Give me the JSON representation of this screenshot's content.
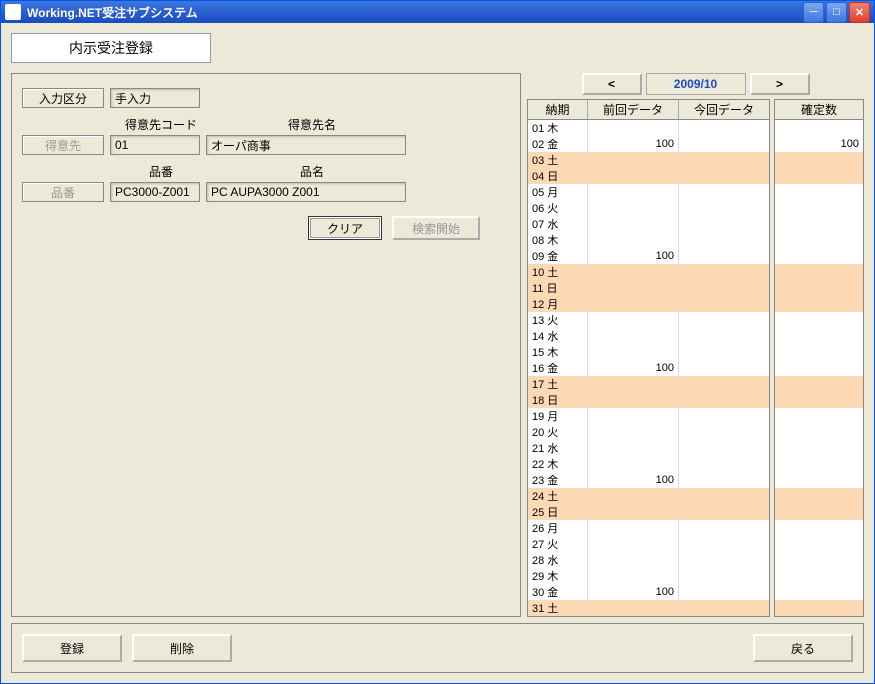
{
  "window": {
    "title": "Working.NET受注サブシステム"
  },
  "page": {
    "title": "内示受注登録"
  },
  "form": {
    "input_div_label": "入力区分",
    "input_div_value": "手入力",
    "customer_btn": "得意先",
    "customer_code_label": "得意先コード",
    "customer_code_value": "01",
    "customer_name_label": "得意先名",
    "customer_name_value": "オーパ商事",
    "product_btn": "品番",
    "product_code_label": "品番",
    "product_code_value": "PC3000-Z001",
    "product_name_label": "品名",
    "product_name_value": "PC AUPA3000 Z001",
    "clear_btn": "クリア",
    "search_btn": "検索開始"
  },
  "month": {
    "display": "2009/10"
  },
  "grid": {
    "headers": {
      "date": "納期",
      "prev": "前回データ",
      "curr": "今回データ",
      "confirmed": "確定数"
    },
    "rows": [
      {
        "d": "01",
        "w": "木",
        "prev": "",
        "curr": "",
        "conf": "",
        "hl": false
      },
      {
        "d": "02",
        "w": "金",
        "prev": "100",
        "curr": "",
        "conf": "100",
        "hl": false
      },
      {
        "d": "03",
        "w": "土",
        "prev": "",
        "curr": "",
        "conf": "",
        "hl": true
      },
      {
        "d": "04",
        "w": "日",
        "prev": "",
        "curr": "",
        "conf": "",
        "hl": true
      },
      {
        "d": "05",
        "w": "月",
        "prev": "",
        "curr": "",
        "conf": "",
        "hl": false
      },
      {
        "d": "06",
        "w": "火",
        "prev": "",
        "curr": "",
        "conf": "",
        "hl": false
      },
      {
        "d": "07",
        "w": "水",
        "prev": "",
        "curr": "",
        "conf": "",
        "hl": false
      },
      {
        "d": "08",
        "w": "木",
        "prev": "",
        "curr": "",
        "conf": "",
        "hl": false
      },
      {
        "d": "09",
        "w": "金",
        "prev": "100",
        "curr": "",
        "conf": "",
        "hl": false
      },
      {
        "d": "10",
        "w": "土",
        "prev": "",
        "curr": "",
        "conf": "",
        "hl": true
      },
      {
        "d": "11",
        "w": "日",
        "prev": "",
        "curr": "",
        "conf": "",
        "hl": true
      },
      {
        "d": "12",
        "w": "月",
        "prev": "",
        "curr": "",
        "conf": "",
        "hl": true
      },
      {
        "d": "13",
        "w": "火",
        "prev": "",
        "curr": "",
        "conf": "",
        "hl": false
      },
      {
        "d": "14",
        "w": "水",
        "prev": "",
        "curr": "",
        "conf": "",
        "hl": false
      },
      {
        "d": "15",
        "w": "木",
        "prev": "",
        "curr": "",
        "conf": "",
        "hl": false
      },
      {
        "d": "16",
        "w": "金",
        "prev": "100",
        "curr": "",
        "conf": "",
        "hl": false
      },
      {
        "d": "17",
        "w": "土",
        "prev": "",
        "curr": "",
        "conf": "",
        "hl": true
      },
      {
        "d": "18",
        "w": "日",
        "prev": "",
        "curr": "",
        "conf": "",
        "hl": true
      },
      {
        "d": "19",
        "w": "月",
        "prev": "",
        "curr": "",
        "conf": "",
        "hl": false
      },
      {
        "d": "20",
        "w": "火",
        "prev": "",
        "curr": "",
        "conf": "",
        "hl": false
      },
      {
        "d": "21",
        "w": "水",
        "prev": "",
        "curr": "",
        "conf": "",
        "hl": false
      },
      {
        "d": "22",
        "w": "木",
        "prev": "",
        "curr": "",
        "conf": "",
        "hl": false
      },
      {
        "d": "23",
        "w": "金",
        "prev": "100",
        "curr": "",
        "conf": "",
        "hl": false
      },
      {
        "d": "24",
        "w": "土",
        "prev": "",
        "curr": "",
        "conf": "",
        "hl": true
      },
      {
        "d": "25",
        "w": "日",
        "prev": "",
        "curr": "",
        "conf": "",
        "hl": true
      },
      {
        "d": "26",
        "w": "月",
        "prev": "",
        "curr": "",
        "conf": "",
        "hl": false
      },
      {
        "d": "27",
        "w": "火",
        "prev": "",
        "curr": "",
        "conf": "",
        "hl": false
      },
      {
        "d": "28",
        "w": "水",
        "prev": "",
        "curr": "",
        "conf": "",
        "hl": false
      },
      {
        "d": "29",
        "w": "木",
        "prev": "",
        "curr": "",
        "conf": "",
        "hl": false
      },
      {
        "d": "30",
        "w": "金",
        "prev": "100",
        "curr": "",
        "conf": "",
        "hl": false
      },
      {
        "d": "31",
        "w": "土",
        "prev": "",
        "curr": "",
        "conf": "",
        "hl": true
      }
    ]
  },
  "bottom": {
    "register": "登録",
    "delete": "削除",
    "back": "戻る"
  }
}
